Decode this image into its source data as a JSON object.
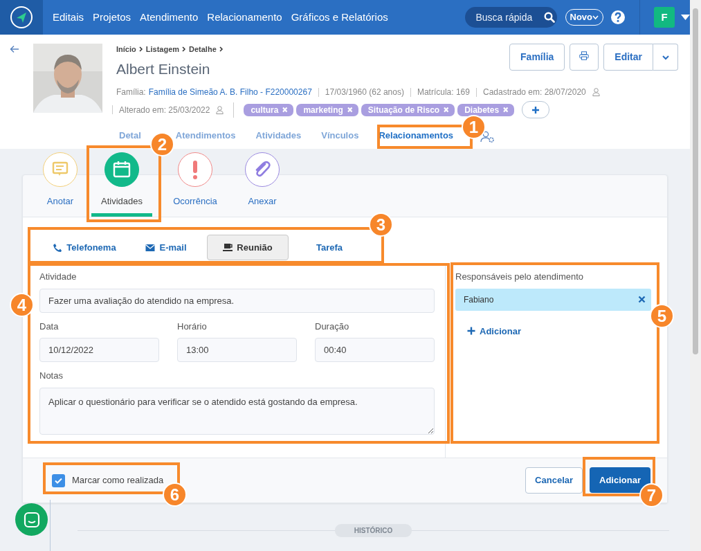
{
  "navbar": {
    "menu": [
      "Editais",
      "Projetos",
      "Atendimento",
      "Relacionamento",
      "Gráficos e Relatórios"
    ],
    "search": {
      "placeholder": "Busca rápida"
    },
    "new_button": "Novo",
    "avatar": "F"
  },
  "header": {
    "breadcrumb": [
      "Início",
      "Listagem",
      "Detalhe"
    ],
    "name": "Albert Einstein",
    "family_label": "Família:",
    "family": "Família de Simeão A. B. Filho - F220000267",
    "meta": [
      "17/03/1960 (62 anos)",
      "Matrícula: 169",
      "Cadastrado em: 28/07/2020"
    ],
    "changed": "Alterado em: 25/03/2022",
    "tags": [
      "cultura",
      "marketing",
      "Situação de Risco",
      "Diabetes"
    ],
    "family_button": "Família",
    "edit_button": "Editar"
  },
  "tabs": [
    {
      "label": "Detal",
      "selected": false
    },
    {
      "label": "Atendimentos",
      "selected": false
    },
    {
      "label": "Atividades",
      "selected": false
    },
    {
      "label": "Vínculos",
      "selected": false
    },
    {
      "label": "Relacionamentos",
      "selected": true
    }
  ],
  "actions": [
    {
      "label": "Anotar",
      "kind": "note",
      "selected": false
    },
    {
      "label": "Atividades",
      "kind": "calendar",
      "selected": true
    },
    {
      "label": "Ocorrência",
      "kind": "alert",
      "selected": false
    },
    {
      "label": "Anexar",
      "kind": "clip",
      "selected": false
    }
  ],
  "activity_types": [
    {
      "label": "Telefonema",
      "kind": "phone",
      "selected": false
    },
    {
      "label": "E-mail",
      "kind": "mail",
      "selected": false
    },
    {
      "label": "Reunião",
      "kind": "cup",
      "selected": true
    },
    {
      "label": "Tarefa",
      "kind": "task",
      "selected": false
    }
  ],
  "form": {
    "activity": {
      "label": "Atividade",
      "value": "Fazer uma avaliação do atendido na empresa."
    },
    "date": {
      "label": "Data",
      "value": "10/12/2022"
    },
    "time": {
      "label": "Horário",
      "value": "13:00"
    },
    "duration": {
      "label": "Duração",
      "value": "00:40"
    },
    "notes": {
      "label": "Notas",
      "value": "Aplicar o questionário para verificar se o atendido está gostando da empresa."
    }
  },
  "responsible": {
    "title": "Responsáveis pelo atendimento",
    "people": [
      "Fabiano"
    ],
    "add": "Adicionar"
  },
  "footer": {
    "done": {
      "label": "Marcar como realizada",
      "checked": true
    },
    "cancel": "Cancelar",
    "submit": "Adicionar"
  },
  "history_label": "HISTÓRICO",
  "callouts": [
    "1",
    "2",
    "3",
    "4",
    "5",
    "6",
    "7"
  ]
}
